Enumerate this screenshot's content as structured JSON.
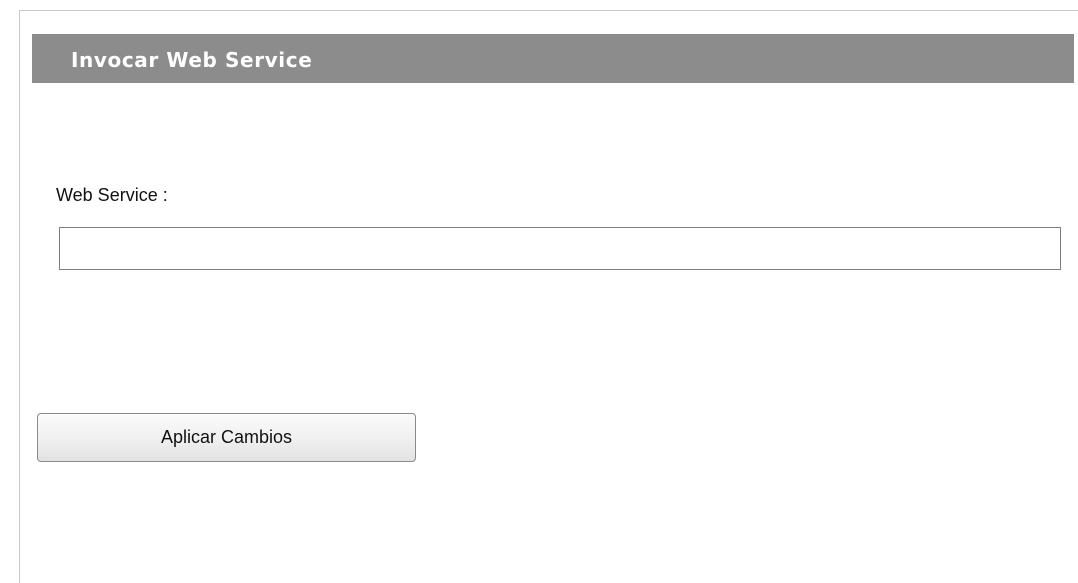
{
  "section": {
    "title": "Invocar Web Service"
  },
  "form": {
    "web_service_label": "Web Service :",
    "web_service_value": "",
    "apply_label": "Aplicar Cambios"
  },
  "colors": {
    "header_background": "#8c8c8c",
    "header_text": "#ffffff"
  }
}
